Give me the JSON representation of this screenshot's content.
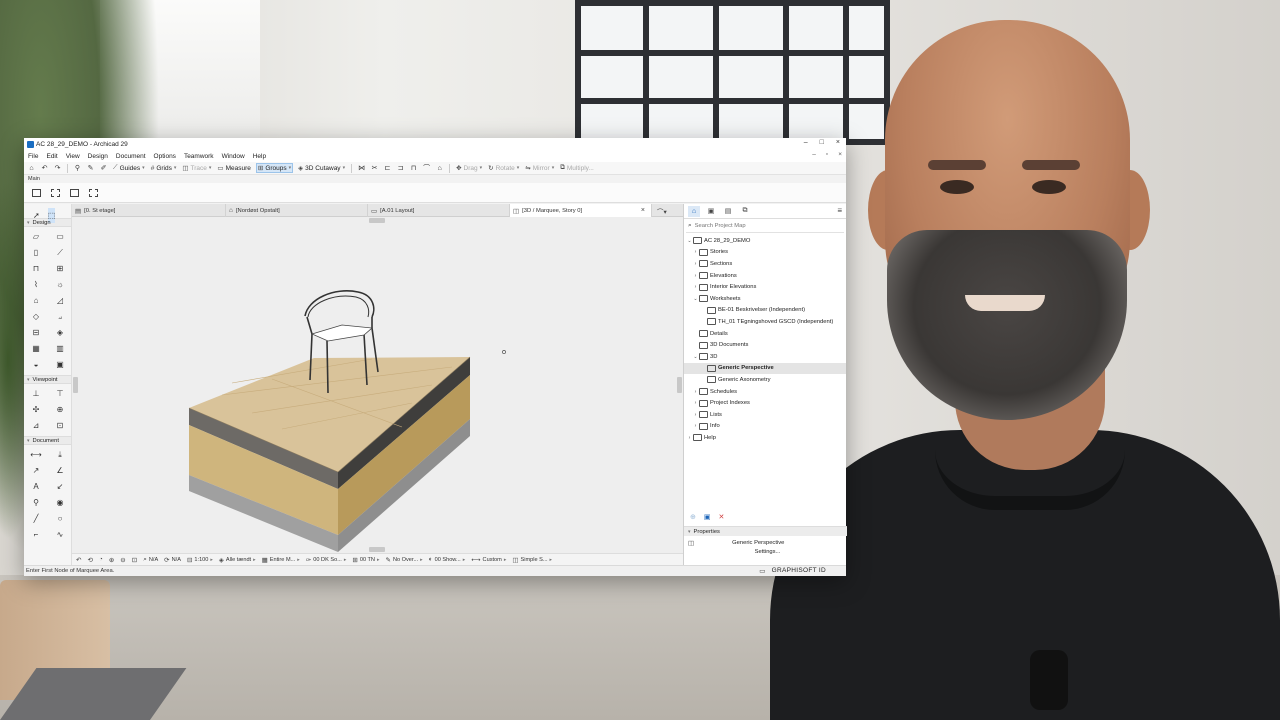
{
  "window": {
    "title": "AC 28_29_DEMO - Archicad 29",
    "controls": [
      "–",
      "□",
      "×"
    ],
    "doc_controls": [
      "–",
      "▫",
      "×"
    ]
  },
  "menubar": [
    "File",
    "Edit",
    "View",
    "Design",
    "Document",
    "Options",
    "Teamwork",
    "Window",
    "Help"
  ],
  "toolbar": {
    "guides": "Guides",
    "grids": "Grids",
    "trace": "Trace",
    "measure": "Measure",
    "groups": "Groups",
    "cutaway": "3D Cutaway",
    "drag": "Drag",
    "rotate": "Rotate",
    "mirror": "Mirror",
    "multiply": "Multiply..."
  },
  "infobox": {
    "label": "Main"
  },
  "toolbox": {
    "sections": {
      "design": "Design",
      "viewpoint": "Viewpoint",
      "document": "Document"
    },
    "icons": {
      "design": [
        "wall-icon",
        "slab-icon",
        "column-icon",
        "beam-icon",
        "door-icon",
        "window-icon",
        "stair-icon",
        "railing-icon",
        "roof-icon",
        "shell-icon",
        "curtain-wall-icon",
        "morph-icon",
        "object-icon",
        "lamp-icon",
        "zone-icon",
        "mesh-icon"
      ],
      "viewpoint": [
        "section-icon",
        "elevation-icon",
        "interior-elevation-icon",
        "worksheet-icon",
        "detail-icon",
        "camera-icon"
      ],
      "document": [
        "dimension-icon",
        "level-dimension-icon",
        "radial-dimension-icon",
        "angle-dimension-icon",
        "text-icon",
        "label-icon",
        "marker-icon",
        "figure-icon",
        "line-icon",
        "circle-icon",
        "polyline-icon",
        "spline-icon"
      ]
    }
  },
  "tabs": [
    {
      "label": "[0. St etage]"
    },
    {
      "label": "[Nordøst Opstalt]"
    },
    {
      "label": "[A.01 Layout]"
    },
    {
      "label": "[3D / Marquee, Story 0]"
    }
  ],
  "statusbar": {
    "na1": "N/A",
    "na2": "N/A",
    "scale": "1:100",
    "layers": "Alle tændt",
    "model": "Entire M...",
    "pen": "00 DK So...",
    "tn": "00 TN",
    "override": "No Over...",
    "show": "00 Show...",
    "custom": "Custom",
    "simple": "Simple S..."
  },
  "status_message": "Enter First Node of Marquee Area.",
  "navigator": {
    "search_placeholder": "Search Project Map",
    "root": "AC 28_29_DEMO",
    "items": [
      {
        "label": "Stories",
        "level": 1,
        "twisty": "›"
      },
      {
        "label": "Sections",
        "level": 1,
        "twisty": "›"
      },
      {
        "label": "Elevations",
        "level": 1,
        "twisty": "›"
      },
      {
        "label": "Interior Elevations",
        "level": 1,
        "twisty": "›"
      },
      {
        "label": "Worksheets",
        "level": 1,
        "twisty": "⌄"
      },
      {
        "label": "BE-01 Beskrivelser (Independent)",
        "level": 2,
        "twisty": ""
      },
      {
        "label": "TH_01 TEgningshoved GSCD (Independent)",
        "level": 2,
        "twisty": ""
      },
      {
        "label": "Details",
        "level": 1,
        "twisty": ""
      },
      {
        "label": "3D Documents",
        "level": 1,
        "twisty": ""
      },
      {
        "label": "3D",
        "level": 1,
        "twisty": "⌄"
      },
      {
        "label": "Generic Perspective",
        "level": 2,
        "twisty": "",
        "selected": true
      },
      {
        "label": "Generic Axonometry",
        "level": 2,
        "twisty": ""
      },
      {
        "label": "Schedules",
        "level": 1,
        "twisty": "›"
      },
      {
        "label": "Project Indexes",
        "level": 1,
        "twisty": "›"
      },
      {
        "label": "Lists",
        "level": 1,
        "twisty": "›"
      },
      {
        "label": "Info",
        "level": 1,
        "twisty": "›"
      },
      {
        "label": "Help",
        "level": 0,
        "twisty": "›"
      }
    ],
    "properties_label": "Properties",
    "properties_value": "Generic Perspective",
    "settings_label": "Settings...",
    "brand": "GRAPHISOFT ID"
  },
  "colors": {
    "accent": "#1a63b8",
    "wood": "#d9c39a",
    "insulation": "#c9b07a",
    "concrete": "#a8a8a8"
  }
}
